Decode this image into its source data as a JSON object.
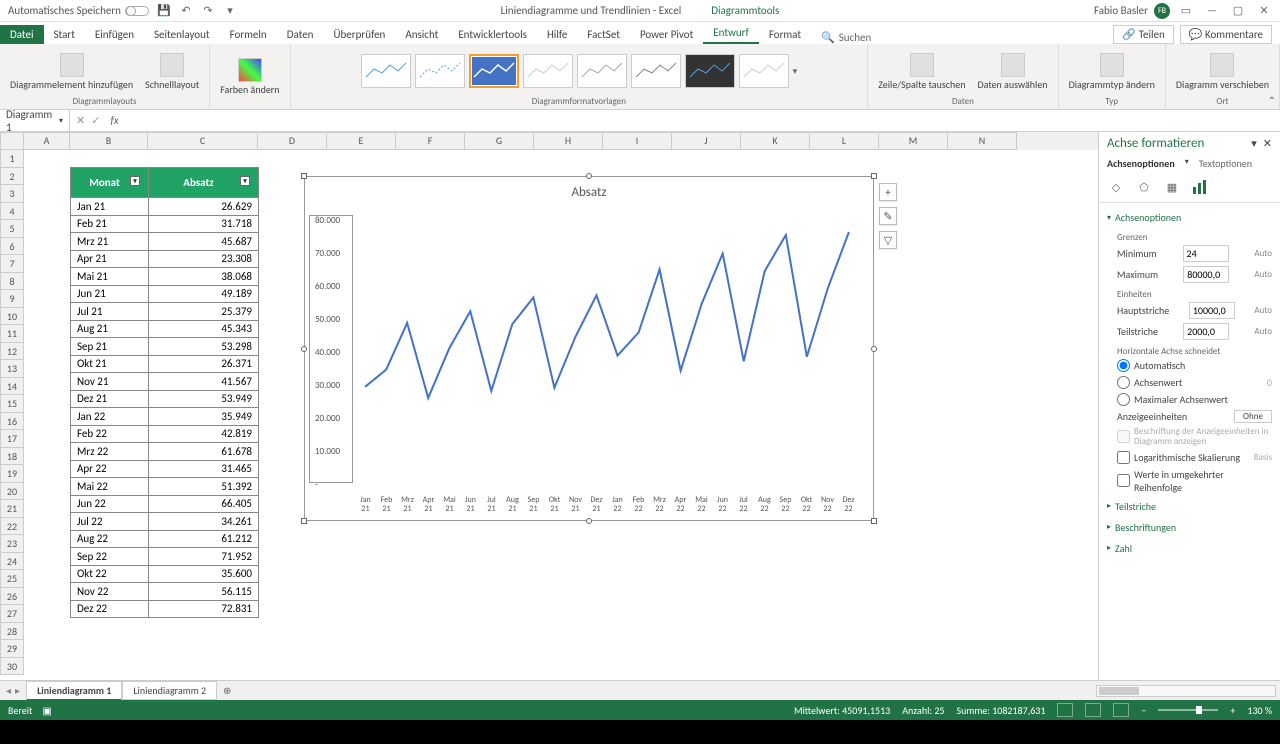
{
  "titlebar": {
    "autosave": "Automatisches Speichern",
    "doc_title": "Liniendiagramme und Trendlinien - Excel",
    "tool_context": "Diagrammtools",
    "username": "Fabio Basler",
    "user_initials": "FB"
  },
  "tabs": {
    "file": "Datei",
    "start": "Start",
    "einfuegen": "Einfügen",
    "seitenlayout": "Seitenlayout",
    "formeln": "Formeln",
    "daten": "Daten",
    "ueberpruefen": "Überprüfen",
    "ansicht": "Ansicht",
    "entwickler": "Entwicklertools",
    "hilfe": "Hilfe",
    "factset": "FactSet",
    "powerpivot": "Power Pivot",
    "entwurf": "Entwurf",
    "format": "Format",
    "suchen": "Suchen",
    "teilen": "Teilen",
    "kommentare": "Kommentare"
  },
  "ribbon": {
    "g1_a": "Diagrammelement\nhinzufügen",
    "g1_b": "Schnelllayout",
    "g1_label": "Diagrammlayouts",
    "g2_a": "Farben\nändern",
    "g2_label": "",
    "g3_label": "Diagrammformatvorlagen",
    "g4_a": "Zeile/Spalte\ntauschen",
    "g4_b": "Daten\nauswählen",
    "g4_label": "Daten",
    "g5_a": "Diagrammtyp\nändern",
    "g5_label": "Typ",
    "g6_a": "Diagramm\nverschieben",
    "g6_label": "Ort"
  },
  "namebox": "Diagramm 1",
  "columns": [
    "A",
    "B",
    "C",
    "D",
    "E",
    "F",
    "G",
    "H",
    "I",
    "J",
    "K",
    "L",
    "M",
    "N"
  ],
  "table": {
    "h1": "Monat",
    "h2": "Absatz",
    "rows": [
      {
        "m": "Jan 21",
        "v": "26.629"
      },
      {
        "m": "Feb 21",
        "v": "31.718"
      },
      {
        "m": "Mrz 21",
        "v": "45.687"
      },
      {
        "m": "Apr 21",
        "v": "23.308"
      },
      {
        "m": "Mai 21",
        "v": "38.068"
      },
      {
        "m": "Jun 21",
        "v": "49.189"
      },
      {
        "m": "Jul 21",
        "v": "25.379"
      },
      {
        "m": "Aug 21",
        "v": "45.343"
      },
      {
        "m": "Sep 21",
        "v": "53.298"
      },
      {
        "m": "Okt 21",
        "v": "26.371"
      },
      {
        "m": "Nov 21",
        "v": "41.567"
      },
      {
        "m": "Dez 21",
        "v": "53.949"
      },
      {
        "m": "Jan 22",
        "v": "35.949"
      },
      {
        "m": "Feb 22",
        "v": "42.819"
      },
      {
        "m": "Mrz 22",
        "v": "61.678"
      },
      {
        "m": "Apr 22",
        "v": "31.465"
      },
      {
        "m": "Mai 22",
        "v": "51.392"
      },
      {
        "m": "Jun 22",
        "v": "66.405"
      },
      {
        "m": "Jul 22",
        "v": "34.261"
      },
      {
        "m": "Aug 22",
        "v": "61.212"
      },
      {
        "m": "Sep 22",
        "v": "71.952"
      },
      {
        "m": "Okt 22",
        "v": "35.600"
      },
      {
        "m": "Nov 22",
        "v": "56.115"
      },
      {
        "m": "Dez 22",
        "v": "72.831"
      }
    ]
  },
  "chart_data": {
    "type": "line",
    "title": "Absatz",
    "categories": [
      "Jan 21",
      "Feb 21",
      "Mrz 21",
      "Apr 21",
      "Mai 21",
      "Jun 21",
      "Jul 21",
      "Aug 21",
      "Sep 21",
      "Okt 21",
      "Nov 21",
      "Dez 21",
      "Jan 22",
      "Feb 22",
      "Mrz 22",
      "Apr 22",
      "Mai 22",
      "Jun 22",
      "Jul 22",
      "Aug 22",
      "Sep 22",
      "Okt 22",
      "Nov 22",
      "Dez 22"
    ],
    "values": [
      26629,
      31718,
      45687,
      23308,
      38068,
      49189,
      25379,
      45343,
      53298,
      26371,
      41567,
      53949,
      35949,
      42819,
      61678,
      31465,
      51392,
      66405,
      34261,
      61212,
      71952,
      35600,
      56115,
      72831
    ],
    "ylabels": [
      "80.000",
      "70.000",
      "60.000",
      "50.000",
      "40.000",
      "30.000",
      "20.000",
      "10.000",
      "-"
    ],
    "ylim": [
      0,
      80000
    ]
  },
  "pane": {
    "title": "Achse formatieren",
    "tab1": "Achsenoptionen",
    "tab2": "Textoptionen",
    "sec_axopt": "Achsenoptionen",
    "grenzen": "Grenzen",
    "min_l": "Minimum",
    "min_v": "24",
    "auto": "Auto",
    "max_l": "Maximum",
    "max_v": "80000,0",
    "einheiten": "Einheiten",
    "haupt_l": "Hauptstriche",
    "haupt_v": "10000,0",
    "teil_l": "Teilstriche",
    "teil_v": "2000,0",
    "hachse": "Horizontale Achse schneidet",
    "auto_r": "Automatisch",
    "achsw_r": "Achsenwert",
    "achsw_v": "0",
    "max_r": "Maximaler Achsenwert",
    "anzeige_l": "Anzeigeeinheiten",
    "anzeige_v": "Ohne",
    "anzeige_desc": "Beschriftung der Anzeigeeinheiten in Diagramm anzeigen",
    "log_l": "Logarithmische Skalierung",
    "basis_l": "Basis",
    "rev_l": "Werte in umgekehrter Reihenfolge",
    "sec_teil": "Teilstriche",
    "sec_besch": "Beschriftungen",
    "sec_zahl": "Zahl"
  },
  "sheets": {
    "s1": "Liniendiagramm 1",
    "s2": "Liniendiagramm 2"
  },
  "status": {
    "bereit": "Bereit",
    "mw": "Mittelwert: 45091,1513",
    "anz": "Anzahl: 25",
    "sum": "Summe: 1082187,631",
    "zoom": "130 %"
  }
}
